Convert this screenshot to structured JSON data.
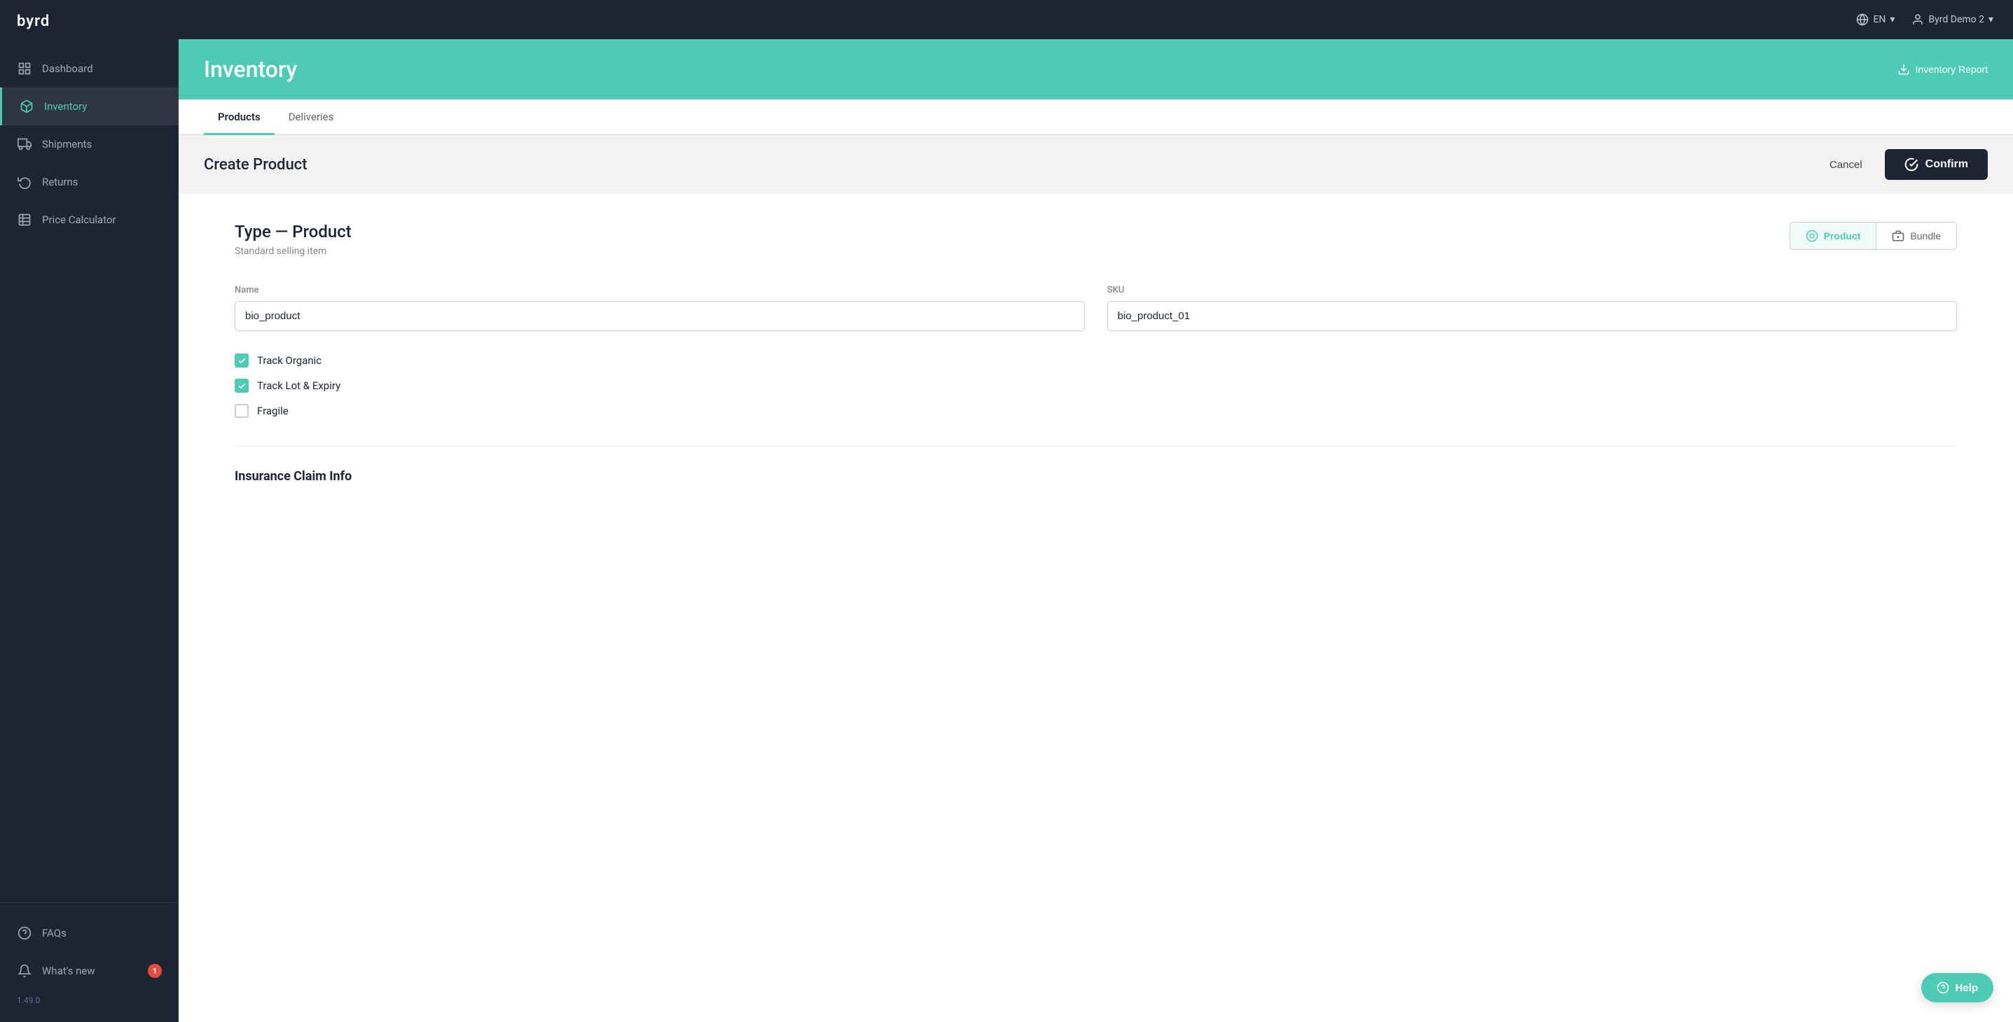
{
  "app": {
    "logo": "byrd"
  },
  "topbar": {
    "language": "EN",
    "user": "Byrd Demo 2",
    "chevron_icon": "▾",
    "globe_icon": "🌐"
  },
  "sidebar": {
    "items": [
      {
        "id": "dashboard",
        "label": "Dashboard",
        "icon": "grid"
      },
      {
        "id": "inventory",
        "label": "Inventory",
        "icon": "box",
        "active": true
      },
      {
        "id": "shipments",
        "label": "Shipments",
        "icon": "truck"
      },
      {
        "id": "returns",
        "label": "Returns",
        "icon": "refresh"
      },
      {
        "id": "price-calculator",
        "label": "Price Calculator",
        "icon": "table"
      }
    ],
    "bottom_items": [
      {
        "id": "faqs",
        "label": "FAQs",
        "icon": "help-circle"
      },
      {
        "id": "whats-new",
        "label": "What's new",
        "icon": "bell",
        "badge": "1"
      }
    ],
    "version": "1.49.0"
  },
  "page": {
    "title": "Inventory",
    "inventory_report_btn": "Inventory Report"
  },
  "tabs": [
    {
      "id": "products",
      "label": "Products",
      "active": true
    },
    {
      "id": "deliveries",
      "label": "Deliveries",
      "active": false
    }
  ],
  "create_product": {
    "title": "Create Product",
    "cancel_label": "Cancel",
    "confirm_label": "Confirm"
  },
  "form": {
    "type_label": "Type — Product",
    "type_description": "Standard selling item",
    "type_product_label": "Product",
    "type_bundle_label": "Bundle",
    "name_label": "Name",
    "name_value": "bio_product",
    "sku_label": "SKU",
    "sku_value": "bio_product_01",
    "checkboxes": [
      {
        "id": "track-organic",
        "label": "Track Organic",
        "checked": true
      },
      {
        "id": "track-lot-expiry",
        "label": "Track Lot & Expiry",
        "checked": true
      },
      {
        "id": "fragile",
        "label": "Fragile",
        "checked": false
      }
    ],
    "insurance_section_title": "Insurance Claim Info"
  },
  "help_btn": "Help"
}
